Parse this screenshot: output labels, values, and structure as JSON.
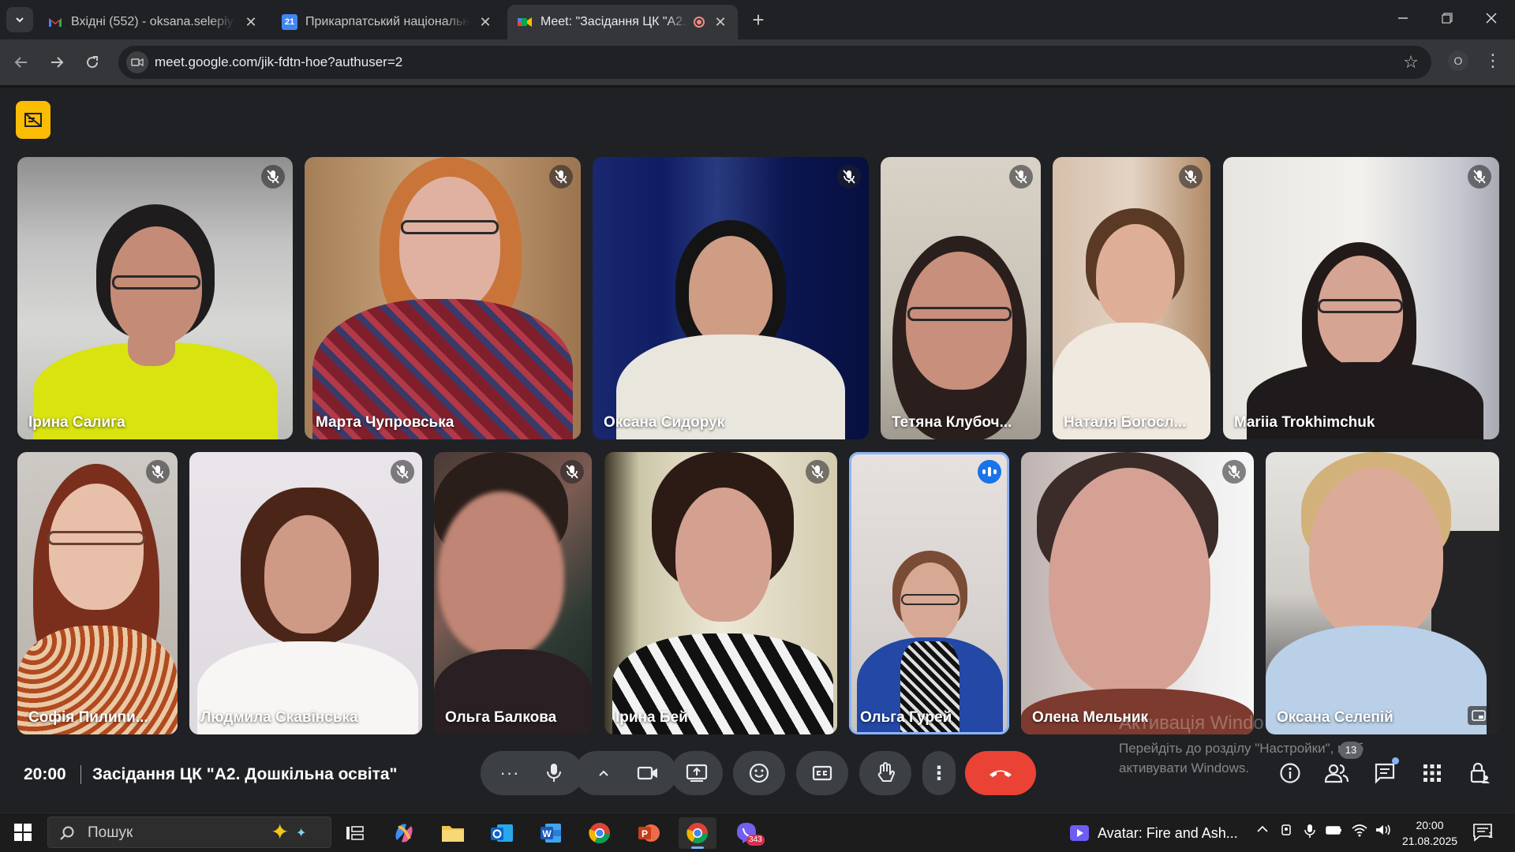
{
  "browser": {
    "tabs": [
      {
        "title": "Вхідні (552) - oksana.selepiy@p",
        "favicon": "gmail-icon"
      },
      {
        "title": "Прикарпатський національни",
        "favicon": "calendar-icon",
        "favicon_text": "21"
      },
      {
        "title": "Meet: \"Засідання ЦК \"А2. Д",
        "favicon": "meet-icon"
      }
    ],
    "active_tab": 2,
    "url": "meet.google.com/jik-fdtn-hoe?authuser=2",
    "profile_initial": "O"
  },
  "meet": {
    "participants": [
      {
        "name": "Ірина Салига",
        "muted": true
      },
      {
        "name": "Марта Чупровська",
        "muted": true
      },
      {
        "name": "Оксана Сидорук",
        "muted": true
      },
      {
        "name": "Тетяна Клубоч...",
        "muted": true
      },
      {
        "name": "Наталя Богосл...",
        "muted": true
      },
      {
        "name": "Mariia Trokhimchuk",
        "muted": true
      },
      {
        "name": "Софія Пилипи...",
        "muted": true
      },
      {
        "name": "Людмила Скавінська",
        "muted": true
      },
      {
        "name": "Ольга Балкова",
        "muted": true
      },
      {
        "name": "Ірина Бей",
        "muted": true
      },
      {
        "name": "Ольга Гурей",
        "muted": false,
        "speaking": true
      },
      {
        "name": "Олена Мельник",
        "muted": true
      },
      {
        "name": "Оксана Селепій",
        "muted": false,
        "self": true
      }
    ],
    "time": "20:00",
    "meeting_title": "Засідання ЦК \"А2. Дошкільна освіта\"",
    "participant_count": "13",
    "end_call_color": "#ea4335",
    "accent": "#8ab4f8"
  },
  "windows_activation": {
    "title": "Активація Windo",
    "text": "Перейдіть до розділу \"Настройки\", щоб активувати Windows."
  },
  "taskbar": {
    "search_label": "Пошук",
    "media_title": "Avatar: Fire and Ash...",
    "time": "20:00",
    "date": "21.08.2025",
    "viber_badge": "343",
    "notification_count": "1"
  }
}
